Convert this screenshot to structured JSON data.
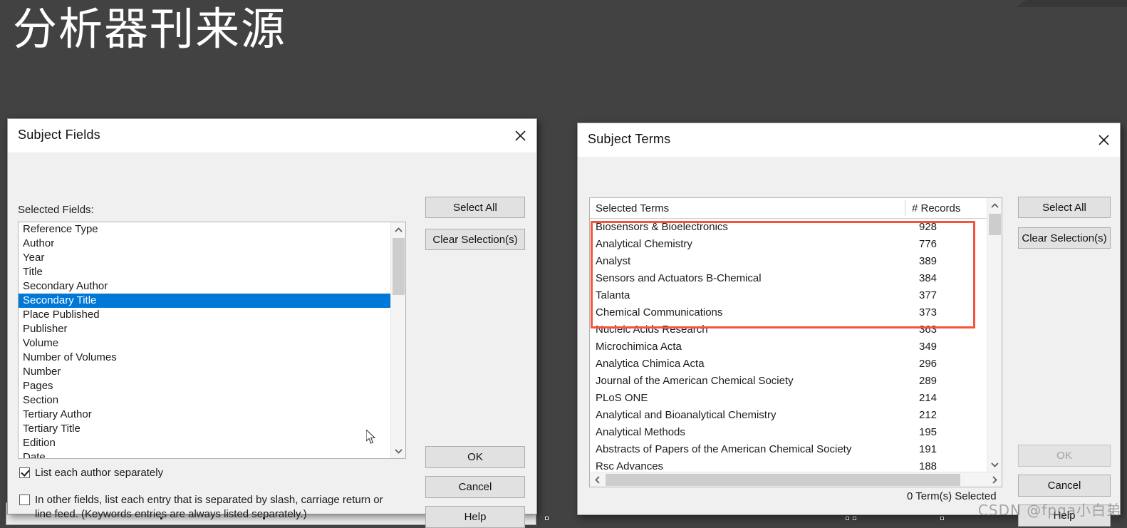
{
  "slide": {
    "title": "分析器刊来源",
    "background_color": "#424242",
    "watermark": "CSDN @fpga小白弟"
  },
  "subject_fields_dialog": {
    "title": "Subject Fields",
    "close_icon": "close-icon",
    "list_label": "Selected Fields:",
    "fields": [
      "Reference Type",
      "Author",
      "Year",
      "Title",
      "Secondary Author",
      "Secondary Title",
      "Place Published",
      "Publisher",
      "Volume",
      "Number of Volumes",
      "Number",
      "Pages",
      "Section",
      "Tertiary Author",
      "Tertiary Title",
      "Edition",
      "Date"
    ],
    "selected_field": "Secondary Title",
    "selected_index": 5,
    "buttons": {
      "select_all": "Select All",
      "clear_selections": "Clear Selection(s)",
      "ok": "OK",
      "cancel": "Cancel",
      "help": "Help"
    },
    "checkboxes": [
      {
        "label": "List each author separately",
        "checked": true
      },
      {
        "label": "In other fields, list each entry that is separated by slash, carriage return or line feed. (Keywords entries are always listed separately.)",
        "checked": false
      }
    ]
  },
  "subject_terms_dialog": {
    "title": "Subject Terms",
    "close_icon": "close-icon",
    "columns": [
      "Selected Terms",
      "# Records"
    ],
    "terms": [
      {
        "name": "Biosensors & Bioelectronics",
        "records": "928",
        "highlighted": true
      },
      {
        "name": "Analytical Chemistry",
        "records": "776",
        "highlighted": true
      },
      {
        "name": "Analyst",
        "records": "389",
        "highlighted": true
      },
      {
        "name": "Sensors and Actuators B-Chemical",
        "records": "384",
        "highlighted": true
      },
      {
        "name": "Talanta",
        "records": "377",
        "highlighted": true
      },
      {
        "name": "Chemical Communications",
        "records": "373",
        "highlighted": true
      },
      {
        "name": "Nucleic Acids Research",
        "records": "363",
        "highlighted": false
      },
      {
        "name": "Microchimica Acta",
        "records": "349",
        "highlighted": false
      },
      {
        "name": "Analytica Chimica Acta",
        "records": "296",
        "highlighted": false
      },
      {
        "name": "Journal of the American Chemical Society",
        "records": "289",
        "highlighted": false
      },
      {
        "name": "PLoS ONE",
        "records": "214",
        "highlighted": false
      },
      {
        "name": "Analytical and Bioanalytical Chemistry",
        "records": "212",
        "highlighted": false
      },
      {
        "name": "Analytical Methods",
        "records": "195",
        "highlighted": false
      },
      {
        "name": "Abstracts of Papers of the American Chemical Society",
        "records": "191",
        "highlighted": false
      },
      {
        "name": "Rsc Advances",
        "records": "188",
        "highlighted": false
      }
    ],
    "buttons": {
      "select_all": "Select All",
      "clear_selections": "Clear Selection(s)",
      "ok": "OK",
      "cancel": "Cancel",
      "help": "Help"
    },
    "ok_disabled": true,
    "status": "0 Term(s) Selected",
    "highlight_color": "#f4543c"
  }
}
